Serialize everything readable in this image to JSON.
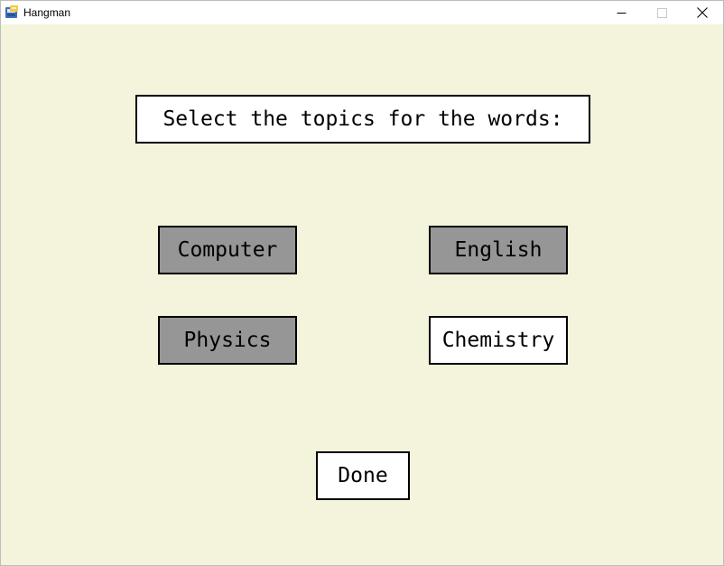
{
  "window": {
    "title": "Hangman",
    "icon": "python-app-icon",
    "controls": [
      "minimize-icon",
      "maximize-icon",
      "close-icon"
    ]
  },
  "screen": {
    "heading": "Select the topics for the words:",
    "topics": [
      {
        "label": "Computer",
        "selected": true
      },
      {
        "label": "English",
        "selected": true
      },
      {
        "label": "Physics",
        "selected": true
      },
      {
        "label": "Chemistry",
        "selected": false
      }
    ],
    "done_label": "Done"
  },
  "colors": {
    "background": "#f4f4dc",
    "selected_fill": "#969696",
    "unselected_fill": "#ffffff",
    "border": "#000000"
  }
}
